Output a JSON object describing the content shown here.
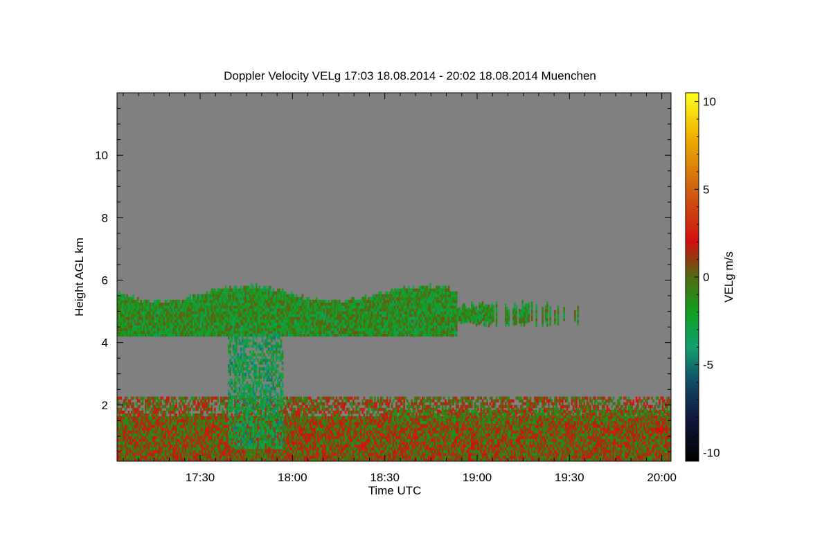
{
  "chart_data": {
    "type": "heatmap",
    "title": "Doppler Velocity VELg   17:03 18.08.2014 - 20:02 18.08.2014 Muenchen",
    "xlabel": "Time UTC",
    "ylabel": "Height AGL km",
    "x_range_minutes_utc": [
      1023,
      1203
    ],
    "x_ticks": [
      {
        "label": "17:30",
        "minute": 1050
      },
      {
        "label": "18:00",
        "minute": 1080
      },
      {
        "label": "18:30",
        "minute": 1110
      },
      {
        "label": "19:00",
        "minute": 1140
      },
      {
        "label": "19:30",
        "minute": 1170
      },
      {
        "label": "20:00",
        "minute": 1200
      }
    ],
    "y_range_km": [
      0.2,
      12.0
    ],
    "y_ticks": [
      "2",
      "4",
      "6",
      "8",
      "10"
    ],
    "colorbar": {
      "label": "VELg m/s",
      "range": [
        -10.5,
        10.5
      ],
      "ticks": [
        "10",
        "5",
        "0",
        "-5",
        "-10"
      ],
      "stops": [
        {
          "value": -10.5,
          "color": "#000000"
        },
        {
          "value": -8,
          "color": "#101840"
        },
        {
          "value": -6,
          "color": "#104a6a"
        },
        {
          "value": -4,
          "color": "#12a070"
        },
        {
          "value": -2,
          "color": "#10a020"
        },
        {
          "value": 0,
          "color": "#506a10"
        },
        {
          "value": 2,
          "color": "#d01010"
        },
        {
          "value": 5,
          "color": "#d06010"
        },
        {
          "value": 8,
          "color": "#f0b000"
        },
        {
          "value": 10.5,
          "color": "#ffff20"
        }
      ]
    },
    "background_color": "#808080",
    "regions": [
      {
        "name": "mid-level cloud layer",
        "t_start": 1023,
        "t_end": 1173,
        "z_bottom_km": 4.2,
        "z_top_km": 5.6,
        "mean_velocity": -1.5
      },
      {
        "name": "boundary layer",
        "t_start": 1023,
        "t_end": 1203,
        "z_bottom_km": 0.2,
        "z_top_km": 2.2,
        "mean_velocity": 0.5
      },
      {
        "name": "updraft column",
        "t_start": 1059,
        "t_end": 1077,
        "z_bottom_km": 0.6,
        "z_top_km": 4.2,
        "mean_velocity": -3
      },
      {
        "name": "upper boundary layer band",
        "t_start": 1110,
        "t_end": 1203,
        "z_bottom_km": 1.4,
        "z_top_km": 1.8,
        "mean_velocity": 0
      }
    ]
  }
}
